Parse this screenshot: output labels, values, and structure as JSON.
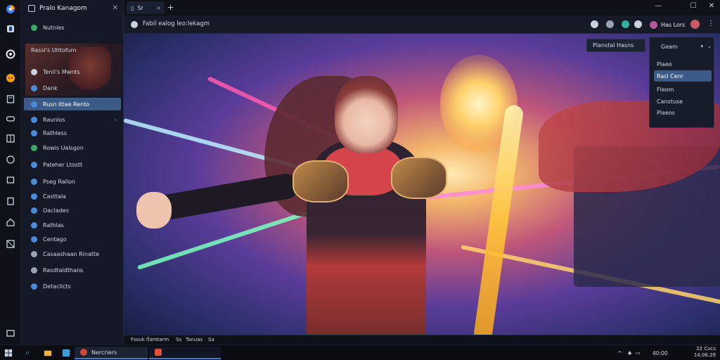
{
  "rail": {
    "icons": [
      "browser-icon",
      "store-icon",
      "settings-icon",
      "chat-icon",
      "book-icon",
      "gamepad-icon",
      "grid-icon",
      "compass-icon",
      "cube-icon",
      "clipboard-icon",
      "home-icon",
      "layers-icon",
      "tray-icon"
    ]
  },
  "sidebar": {
    "title": "Pralo Kanagom",
    "items": [
      {
        "label": "Nutnles",
        "color": "#3aa86a"
      },
      {
        "label": "Rassl's Uhtofum",
        "color": "#c9d2df"
      },
      {
        "label": "Tenil's Mwnts",
        "color": "#4a8ad8"
      },
      {
        "label": "Dank",
        "color": "#4a8ad8"
      },
      {
        "label": "Rusn Ittae Rento",
        "color": "#4a8ad8"
      },
      {
        "label": "Raunlos",
        "color": "#4a8ad8"
      },
      {
        "label": "Rathless",
        "color": "#4a8ad8"
      },
      {
        "label": "Rowis Ualsgon",
        "color": "#3aa86a"
      },
      {
        "label": "Pateher Ltostt",
        "color": "#4a8ad8"
      },
      {
        "label": "Pseg Rallon",
        "color": "#4a8ad8"
      },
      {
        "label": "Casttala",
        "color": "#4a8ad8"
      },
      {
        "label": "Oaclades",
        "color": "#4a8ad8"
      },
      {
        "label": "Rathlas",
        "color": "#4a8ad8"
      },
      {
        "label": "Centago",
        "color": "#4a8ad8"
      },
      {
        "label": "Casaashaan Rinatte",
        "color": "#9aa4b5"
      },
      {
        "label": "Rasdtaldthans",
        "color": "#9aa4b5"
      },
      {
        "label": "Detacllcts",
        "color": "#4a8ad8"
      }
    ]
  },
  "tabs": [
    {
      "label": "Sr",
      "close": "×"
    }
  ],
  "newtab": "+",
  "window": {
    "minimize": "—",
    "maximize": "☐",
    "close": "✕"
  },
  "address": {
    "url": "Fabil ealog leo:lekagm"
  },
  "profile": {
    "name": "Has Lors"
  },
  "overlay": {
    "label": "Planstal Hasns",
    "select": "Geam",
    "options": [
      "Plaeo",
      "Rasl Cenr",
      "Fleom",
      "Canstuse",
      "Plaeos"
    ],
    "selected_index": 1
  },
  "status": {
    "items": [
      "Fssuk flamtarm",
      "Ss",
      "Tanuas",
      "Sa"
    ]
  },
  "taskbar": {
    "task1": "Nercriers",
    "clock_time": "22 Cocs",
    "clock_date": "14.06.29"
  },
  "tray": {
    "items": [
      "^",
      "♠",
      "40:00"
    ]
  }
}
